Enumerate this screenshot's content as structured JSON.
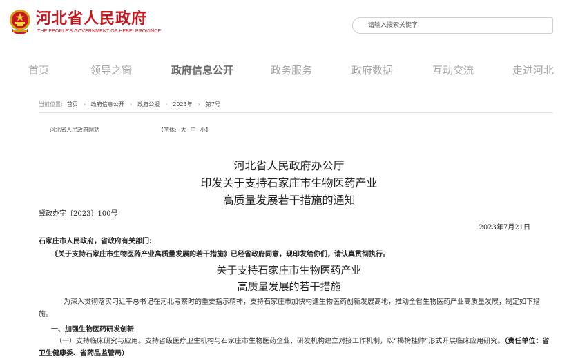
{
  "header": {
    "site_name": "河北省人民政府",
    "site_name_en": "THE PEOPLE'S GOVERNMENT OF HEBEI PROVINCE",
    "search_placeholder": "请输入搜索关键字",
    "brand_color": "#c7161e"
  },
  "nav": {
    "items": [
      {
        "label": "首页"
      },
      {
        "label": "领导之窗"
      },
      {
        "label": "政府信息公开",
        "active": true
      },
      {
        "label": "政务服务"
      },
      {
        "label": "政府数据"
      },
      {
        "label": "互动交流"
      },
      {
        "label": "走进河北"
      }
    ]
  },
  "breadcrumb": {
    "prefix": "当前位置:",
    "items": [
      "首页",
      "政府信息公开",
      "政府公报",
      "2023年",
      "第7号"
    ]
  },
  "meta": {
    "source": "河北省人民政府网站",
    "font_label": "【字体:",
    "font_large": "大",
    "font_medium": "中",
    "font_small": "小】"
  },
  "document": {
    "title_line1": "河北省人民政府办公厅",
    "title_line2": "印发关于支持石家庄市生物医药产业",
    "title_line3": "高质量发展若干措施的通知",
    "doc_number": "冀政办字〔2023〕100号",
    "date": "2023年7月21日",
    "addressee": "石家庄市人民政府，省政府有关部门:",
    "notice": "《关于支持石家庄市生物医药产业高质量发展的若干措施》已经省政府同意，现印发给你们，请认真贯彻执行。",
    "subtitle_line1": "关于支持石家庄市生物医药产业",
    "subtitle_line2": "高质量发展的若干措施",
    "intro": "为深入贯彻落实习近平总书记在河北考察时的重要指示精神，支持石家庄市加快构建生物医药创新发展高地，推动全省生物医药产业高质量发展，制定如下措施。",
    "section1": "一、加强生物医药研发创新",
    "item1": "（一）支持临床研究与应用。支持省级医疗卫生机构与石家庄市生物医药企业、研发机构建立对接工作机制，以“揭榜挂帅”形式开展临床应用研究。",
    "item1_resp": "（责任单位：省卫生健康委、省药品监管局）"
  }
}
